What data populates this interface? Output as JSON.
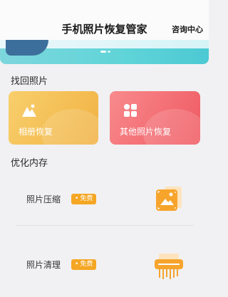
{
  "header": {
    "title": "手机照片恢复管家",
    "consult_label": "咨询中心"
  },
  "sections": {
    "recover_title": "找回照片",
    "optimize_title": "优化内存"
  },
  "cards": {
    "album": {
      "label": "相册恢复",
      "icon": "mountain-photo-icon"
    },
    "other": {
      "label": "其他照片恢复",
      "icon": "grid-icon"
    }
  },
  "tools": [
    {
      "label": "照片压缩",
      "badge": "免费",
      "icon": "compress-photo-icon"
    },
    {
      "label": "照片清理",
      "badge": "免费",
      "icon": "shredder-icon"
    }
  ],
  "colors": {
    "badge": "#f5a623",
    "album_card": "#f5bf55",
    "other_card": "#f4707a"
  }
}
